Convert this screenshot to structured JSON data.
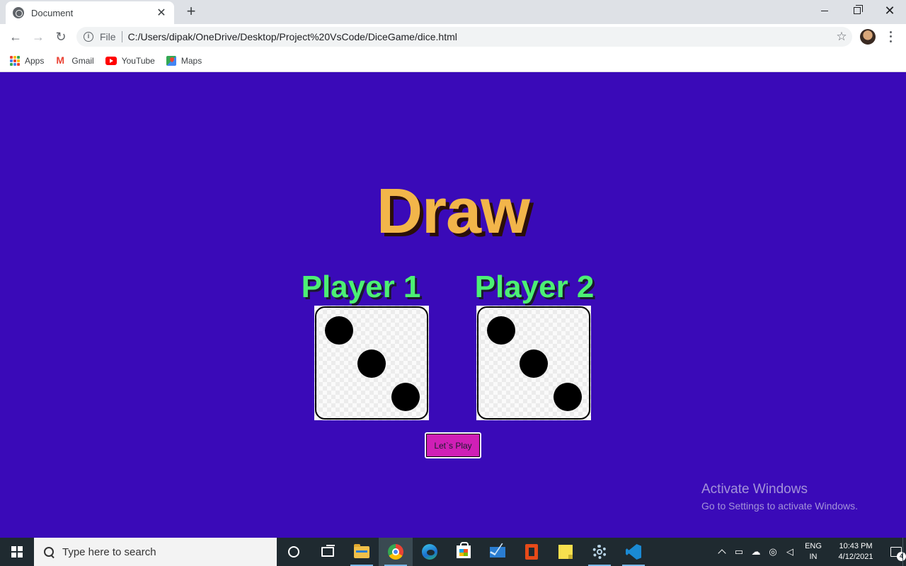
{
  "browser": {
    "tab_title": "Document",
    "tab_close": "✕",
    "new_tab": "+",
    "scheme_label": "File",
    "url": "C:/Users/dipak/OneDrive/Desktop/Project%20VsCode/DiceGame/dice.html",
    "back": "←",
    "forward": "→",
    "reload": "↻",
    "bookmark_star": "☆",
    "info": "i",
    "close_window": "✕"
  },
  "bookmarks": [
    {
      "label": "Apps",
      "icon": "apps-grid-icon"
    },
    {
      "label": "Gmail",
      "icon": "gmail-icon"
    },
    {
      "label": "YouTube",
      "icon": "youtube-icon"
    },
    {
      "label": "Maps",
      "icon": "maps-icon"
    }
  ],
  "apps_icon_colors": [
    "#ea4335",
    "#fbbc05",
    "#34a853",
    "#4285f4",
    "#ea4335",
    "#fbbc05",
    "#34a853",
    "#4285f4",
    "#ea4335"
  ],
  "game": {
    "headline": "Draw",
    "players": [
      {
        "name": "Player 1",
        "die_value": 3
      },
      {
        "name": "Player 2",
        "die_value": 3
      }
    ],
    "play_button": "Let`s Play",
    "colors": {
      "background": "#3a0ab8",
      "headline": "#f2b54a",
      "player_name": "#4cf074",
      "button": "#d01fb6"
    }
  },
  "watermark": {
    "title": "Activate Windows",
    "subtitle": "Go to Settings to activate Windows."
  },
  "taskbar": {
    "search_placeholder": "Type here to search",
    "apps": [
      "cortana-icon",
      "task-view-icon",
      "file-explorer-icon",
      "chrome-icon",
      "edge-icon",
      "store-icon",
      "mail-icon",
      "office-icon",
      "sticky-notes-icon",
      "settings-icon",
      "vscode-icon"
    ],
    "tray": {
      "lang_line1": "ENG",
      "lang_line2": "IN",
      "time": "10:43 PM",
      "date": "4/12/2021",
      "notification_count": "4"
    }
  }
}
